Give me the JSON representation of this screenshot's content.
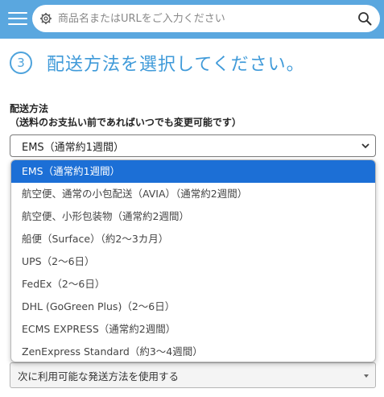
{
  "header": {
    "search_placeholder": "商品名またはURLをご入力ください"
  },
  "step": {
    "number": "3",
    "title": "配送方法を選択してください。"
  },
  "shipping": {
    "label": "配送方法",
    "note": "（送料のお支払い前であればいつでも変更可能です）",
    "selected_value": "EMS（通常約1週間）",
    "options": [
      "EMS（通常約1週間）",
      "航空便、通常の小包配送（AVIA）（通常約2週間）",
      "航空便、小形包装物（通常約2週間）",
      "船便（Surface）（約2～3カ月）",
      "UPS（2～6日）",
      "FedEx（2～6日）",
      "DHL (GoGreen Plus)（2～6日）",
      "ECMS EXPRESS（通常約2週間）",
      "ZenExpress Standard（約3～4週間）"
    ]
  },
  "fallback": {
    "selected_value": "次に利用可能な発送方法を使用する"
  },
  "colors": {
    "header_bg": "#5aa7df",
    "accent": "#3f9ad9",
    "selected_option_bg": "#1c6fd6"
  },
  "icons": {
    "menu": "hamburger-icon",
    "settings": "gear-icon",
    "search": "search-icon",
    "dropdown": "chevron-down-icon"
  }
}
